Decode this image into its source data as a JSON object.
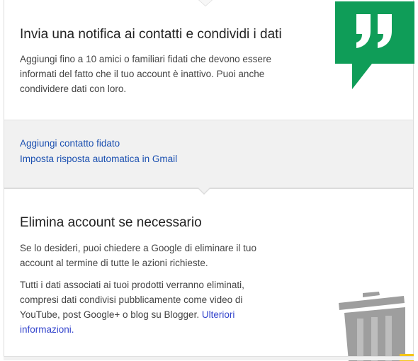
{
  "notify_section": {
    "title": "Invia una notifica ai contatti e condividi i dati",
    "description": "Aggiungi fino a 10 amici o familiari fidati che devono essere informati del fatto che il tuo account è inattivo. Puoi anche condividere dati con loro.",
    "icon": "hangouts-quote-icon",
    "icon_color": "#0f9d58"
  },
  "actions": {
    "add_contact_label": "Aggiungi contatto fidato",
    "autoreply_label": "Imposta risposta automatica in Gmail",
    "link_color": "#1a4fb0"
  },
  "delete_section": {
    "title": "Elimina account se necessario",
    "paragraph1": "Se lo desideri, puoi chiedere a Google di eliminare il tuo account al termine di tutte le azioni richieste.",
    "paragraph2": "Tutti i dati associati ai tuoi prodotti verranno eliminati, compresi dati condivisi pubblicamente come video di YouTube, post Google+ o blog su Blogger.",
    "more_info_label": "Ulteriori informazioni.",
    "icon": "trash-can-icon"
  }
}
